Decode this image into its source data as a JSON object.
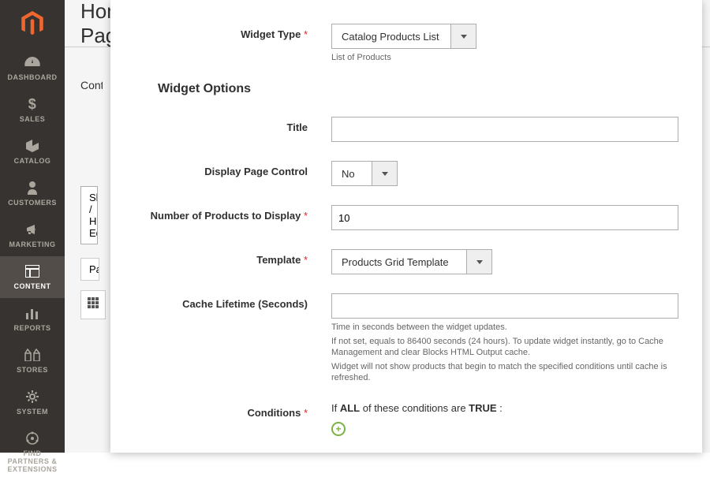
{
  "header": {
    "title": "Home Page"
  },
  "sidebar": {
    "items": [
      {
        "label": "DASHBOARD",
        "icon": "dashboard"
      },
      {
        "label": "SALES",
        "icon": "dollar"
      },
      {
        "label": "CATALOG",
        "icon": "box"
      },
      {
        "label": "CUSTOMERS",
        "icon": "person"
      },
      {
        "label": "MARKETING",
        "icon": "megaphone"
      },
      {
        "label": "CONTENT",
        "icon": "layout"
      },
      {
        "label": "REPORTS",
        "icon": "bars"
      },
      {
        "label": "STORES",
        "icon": "stores"
      },
      {
        "label": "SYSTEM",
        "icon": "gear"
      },
      {
        "label": "FIND PARTNERS & EXTENSIONS",
        "icon": "partners"
      }
    ],
    "active_index": 5
  },
  "background": {
    "section_label": "Content",
    "btn": "Show / Hide Editor",
    "tab": "Paragraph"
  },
  "panel": {
    "widget_type": {
      "label": "Widget Type",
      "value": "Catalog Products List",
      "hint": "List of Products"
    },
    "options_title": "Widget Options",
    "title_field": {
      "label": "Title",
      "value": ""
    },
    "display_control": {
      "label": "Display Page Control",
      "value": "No"
    },
    "num_products": {
      "label": "Number of Products to Display",
      "value": "10"
    },
    "template": {
      "label": "Template",
      "value": "Products Grid Template"
    },
    "cache": {
      "label": "Cache Lifetime (Seconds)",
      "value": "",
      "hint1": "Time in seconds between the widget updates.",
      "hint2": "If not set, equals to 86400 seconds (24 hours). To update widget instantly, go to Cache Management and clear Blocks HTML Output cache.",
      "hint3": "Widget will not show products that begin to match the specified conditions until cache is refreshed."
    },
    "conditions": {
      "label": "Conditions",
      "text_prefix": "If ",
      "text_all": "ALL",
      "text_mid": " of these conditions are ",
      "text_true": "TRUE",
      "text_suffix": " :"
    }
  }
}
